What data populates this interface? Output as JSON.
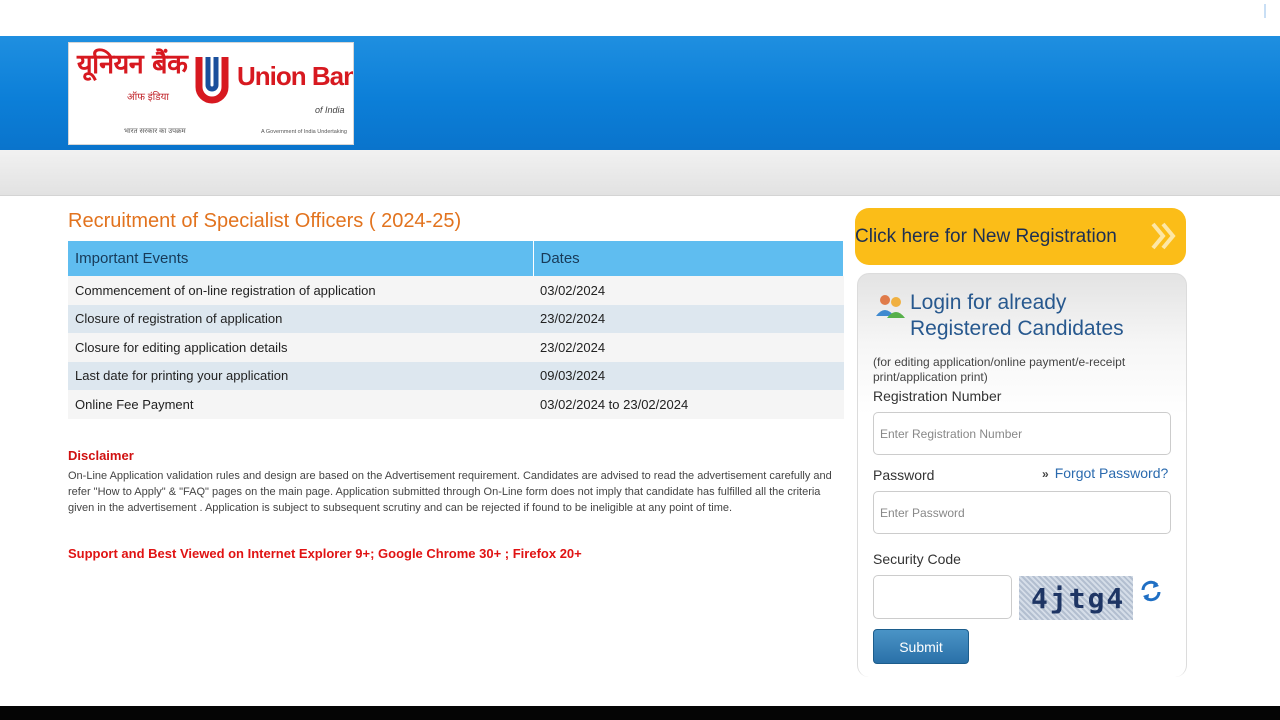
{
  "logo": {
    "hindi": "यूनियन बैंक",
    "hindi_sub": "ऑफ इंडिया",
    "hindi_tag": "भारत सरकार का उपक्रम",
    "english": "Union Bank",
    "english_sub": "of India",
    "english_tag": "A Government of India Undertaking",
    "colors": {
      "red": "#d71920",
      "blue": "#1a4f9c"
    }
  },
  "page_title": "Recruitment of Specialist Officers ( 2024-25)",
  "events_table": {
    "headers": [
      "Important Events",
      "Dates"
    ],
    "rows": [
      [
        "Commencement of on-line registration of application",
        "03/02/2024"
      ],
      [
        "Closure of registration of application",
        "23/02/2024"
      ],
      [
        "Closure for editing application details",
        "23/02/2024"
      ],
      [
        "Last date for printing your application",
        "09/03/2024"
      ],
      [
        "Online Fee Payment",
        "03/02/2024 to 23/02/2024"
      ]
    ]
  },
  "disclaimer": {
    "title": "Disclaimer",
    "text": "On-Line Application validation rules and design are based on the Advertisement requirement. Candidates are advised to read the advertisement carefully and refer \"How to Apply\" & \"FAQ\" pages on the main page. Application submitted through On-Line form does not imply that candidate has fulfilled all the criteria given in the advertisement . Application is subject to subsequent scrutiny and can be rejected if found to be ineligible at any point of time."
  },
  "support_note": "Support and Best Viewed on Internet Explorer 9+; Google Chrome 30+ ; Firefox 20+",
  "new_registration": {
    "label": "Click here for New Registration",
    "icon": "double-chevron-right-icon"
  },
  "login": {
    "icon": "users-icon",
    "heading_line1": "Login for already",
    "heading_line2": "Registered Candidates",
    "subtext": "(for editing application/online payment/e-receipt print/application print)",
    "registration_label": "Registration Number",
    "registration_placeholder": "Enter Registration Number",
    "password_label": "Password",
    "password_placeholder": "Enter Password",
    "forgot_label": "Forgot Password?",
    "forgot_arrow": "»",
    "security_label": "Security Code",
    "captcha_text": "4jtg4",
    "refresh_icon": "refresh-icon",
    "submit_label": "Submit"
  },
  "colors": {
    "header_blue": "#0c7fd8",
    "title_orange": "#e2731e",
    "table_header": "#5fbdf0",
    "registration_yellow": "#fbbd18",
    "disclaimer_red": "#d01010",
    "submit_blue": "#2a70a8"
  }
}
